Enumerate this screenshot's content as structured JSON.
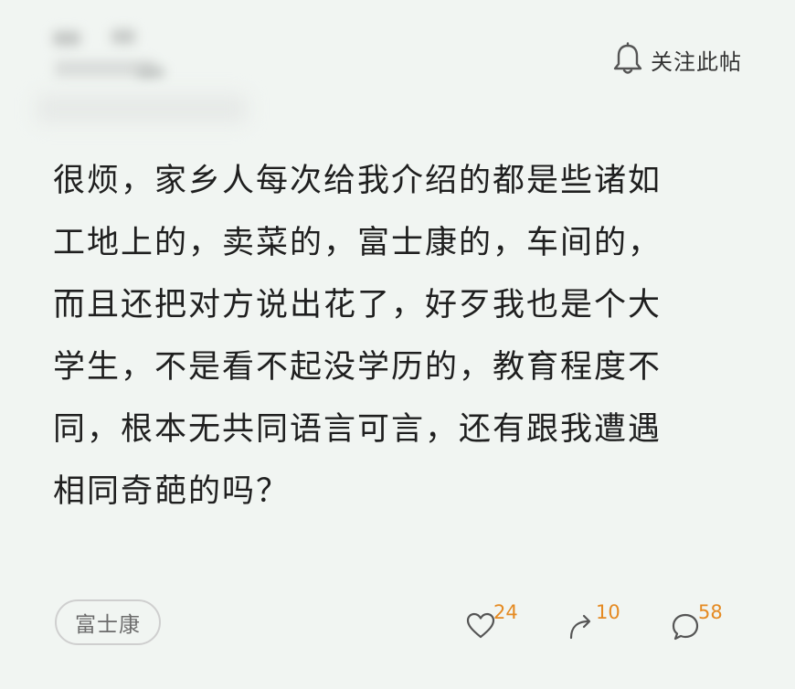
{
  "header": {
    "follow_label": "关注此帖"
  },
  "post": {
    "lines": [
      "很烦，家乡人每次给我介绍的都是些诸如",
      "工地上的，卖菜的，富士康的，车间的，",
      "而且还把对方说出花了，好歹我也是个大",
      "学生，不是看不起没学历的，教育程度不",
      "同，根本无共同语言可言，还有跟我遭遇",
      "相同奇葩的吗？"
    ]
  },
  "footer": {
    "tag_label": "富士康",
    "like_count": "24",
    "share_count": "10",
    "comment_count": "58"
  },
  "icons": {
    "follow": "bell-icon",
    "like": "heart-icon",
    "share": "share-arrow-icon",
    "comment": "comment-bubble-icon"
  },
  "colors": {
    "background": "#f1f5f2",
    "count_accent": "#e58a22",
    "icon_stroke": "#555555"
  }
}
